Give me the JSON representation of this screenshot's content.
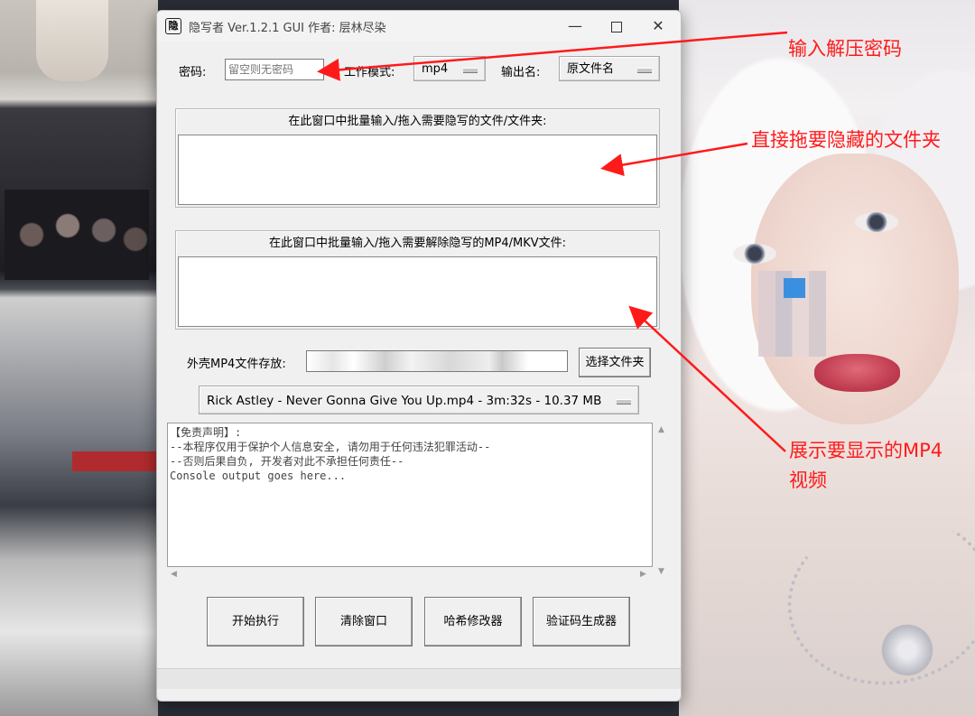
{
  "window": {
    "title": "隐写者 Ver.1.2.1 GUI 作者: 层林尽染",
    "app_icon_glyph": "隐"
  },
  "controls": {
    "password_label": "密码:",
    "password_placeholder": "留空则无密码",
    "mode_label": "工作模式:",
    "mode_value": "mp4",
    "output_label": "输出名:",
    "output_value": "原文件名"
  },
  "hide_panel": {
    "title": "在此窗口中批量输入/拖入需要隐写的文件/文件夹:"
  },
  "reveal_panel": {
    "title": "在此窗口中批量输入/拖入需要解除隐写的MP4/MKV文件:"
  },
  "shell": {
    "label": "外壳MP4文件存放:",
    "choose_button": "选择文件夹",
    "selected_video": "Rick Astley - Never Gonna Give You Up.mp4 - 3m:32s - 10.37 MB"
  },
  "console": {
    "lines": [
      "【免责声明】:",
      "--本程序仅用于保护个人信息安全, 请勿用于任何违法犯罪活动--",
      "--否则后果自负, 开发者对此不承担任何责任--",
      "Console output goes here..."
    ]
  },
  "buttons": {
    "start": "开始执行",
    "clear": "清除窗口",
    "hash": "哈希修改器",
    "captcha": "验证码生成器"
  },
  "annotations": {
    "password_note": "输入解压密码",
    "drag_note": "直接拖要隐藏的文件夹",
    "video_note_line1": "展示要显示的MP4",
    "video_note_line2": "视频"
  },
  "colors": {
    "annotation_red": "#ff1a1a",
    "window_bg": "#f0f0f0"
  }
}
